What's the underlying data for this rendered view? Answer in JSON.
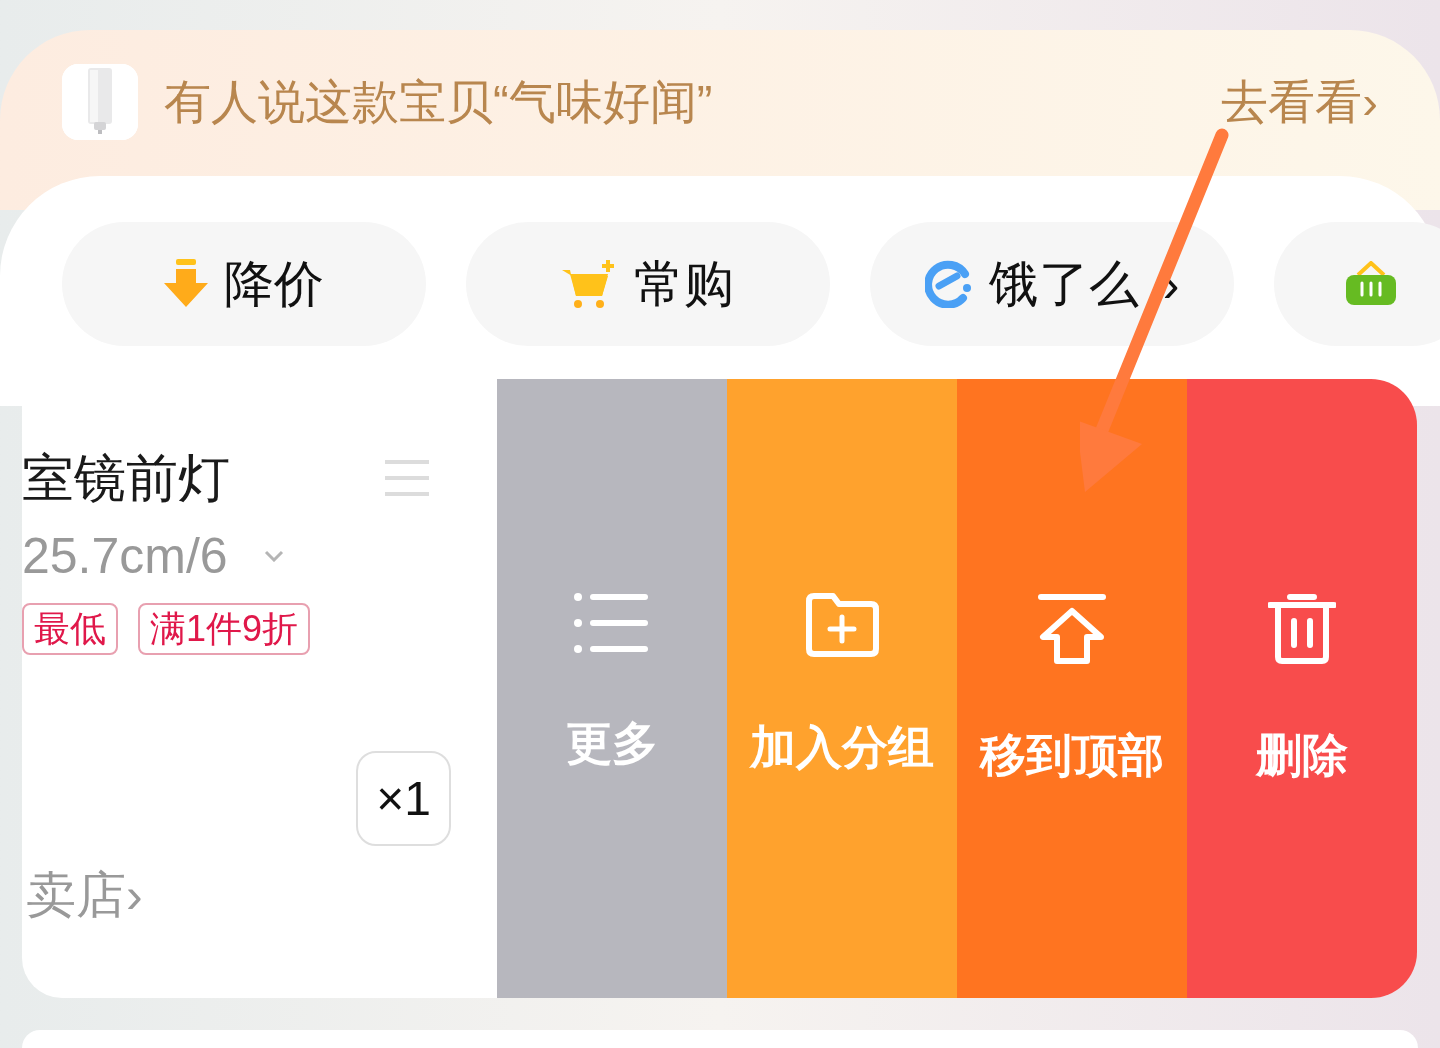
{
  "banner": {
    "text": "有人说这款宝贝“气味好闻”",
    "link": "去看看",
    "chevron": "›"
  },
  "chips": [
    {
      "kind": "price-drop",
      "label": "降价"
    },
    {
      "kind": "cart",
      "label": "常购"
    },
    {
      "kind": "eleme",
      "label": "饿了么",
      "chevron": "›"
    },
    {
      "kind": "basket"
    }
  ],
  "item": {
    "title": "室镜前灯",
    "spec": "25.7cm/6",
    "tags": [
      "最低",
      "满1件9折"
    ],
    "quantity": "×1",
    "shop": "卖店",
    "shop_chevron": "›"
  },
  "actions": [
    {
      "kind": "more",
      "label": "更多"
    },
    {
      "kind": "group",
      "label": "加入分组"
    },
    {
      "kind": "top",
      "label": "移到顶部"
    },
    {
      "kind": "delete",
      "label": "删除"
    }
  ]
}
